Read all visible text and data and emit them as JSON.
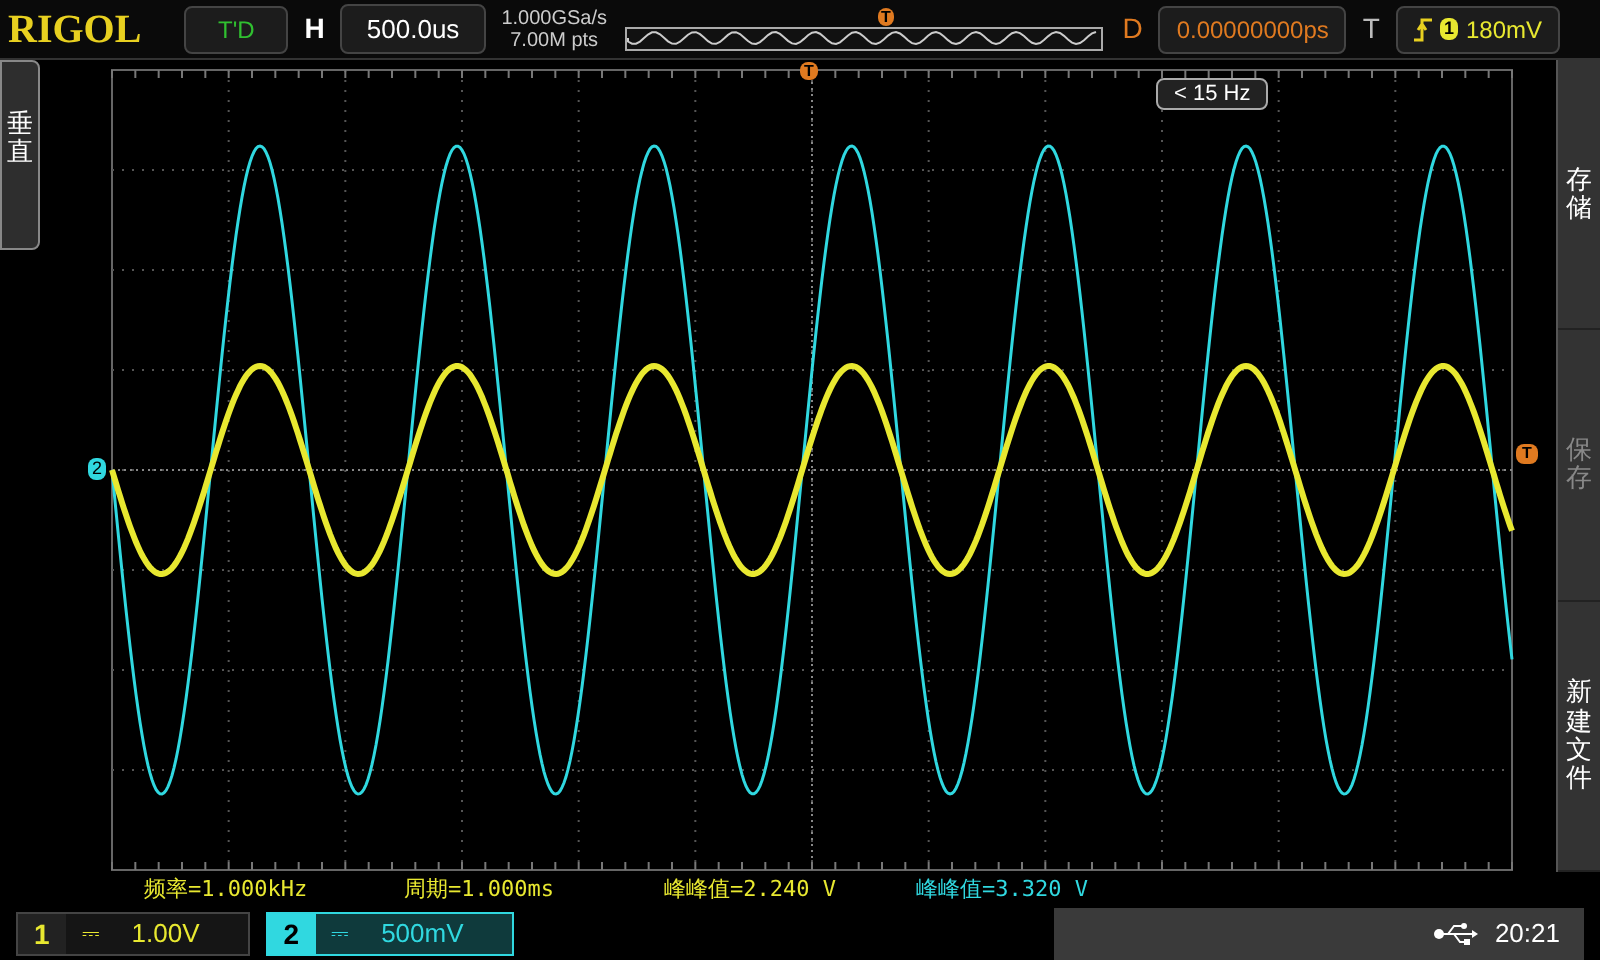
{
  "header": {
    "logo": "RIGOL",
    "mode": "T'D",
    "h_label": "H",
    "timebase": "500.0us",
    "sample_rate": "1.000GSa/s",
    "memory_depth": "7.00M pts",
    "trigger_position_marker": "T",
    "d_label": "D",
    "delay": "0.00000000ps",
    "t_label": "T",
    "trigger_source": "1",
    "trigger_level": "180mV"
  },
  "left_tab": {
    "label": "垂直"
  },
  "plot": {
    "trigger_marker_top": "T",
    "channel_marker": "2",
    "trigger_level_marker": "T",
    "frequency_badge": "< 15 Hz"
  },
  "measurements": [
    {
      "text": "频率=1.000kHz",
      "color": "#e8e830"
    },
    {
      "text": "周期=1.000ms",
      "color": "#e8e830"
    },
    {
      "text": "峰峰值=2.240 V",
      "color": "#e8e830"
    },
    {
      "text": "峰峰值=3.320 V",
      "color": "#30d8e0"
    }
  ],
  "channels": [
    {
      "number": "1",
      "coupling": "⎓",
      "scale": "1.00V",
      "color": "#e8e830",
      "selected": false
    },
    {
      "number": "2",
      "coupling": "⎓",
      "scale": "500mV",
      "color": "#30d8e0",
      "selected": true
    }
  ],
  "right_menu": [
    {
      "label": "存储",
      "disabled": false
    },
    {
      "label": "保存",
      "disabled": true
    },
    {
      "label": "新建文件",
      "disabled": false
    }
  ],
  "status": {
    "time": "20:21"
  }
}
